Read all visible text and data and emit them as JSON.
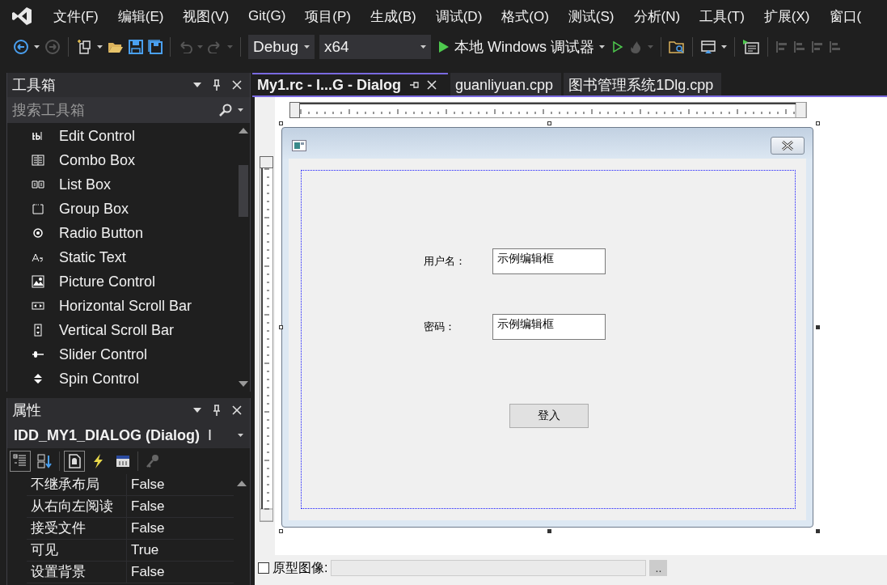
{
  "menu": [
    "文件(F)",
    "编辑(E)",
    "视图(V)",
    "Git(G)",
    "项目(P)",
    "生成(B)",
    "调试(D)",
    "格式(O)",
    "测试(S)",
    "分析(N)",
    "工具(T)",
    "扩展(X)",
    "窗口("
  ],
  "toolbar": {
    "configuration": "Debug",
    "platform": "x64",
    "run_label": "本地 Windows 调试器"
  },
  "toolbox": {
    "title": "工具箱",
    "search": {
      "placeholder": "搜索工具箱"
    },
    "items": [
      {
        "label": "Edit Control"
      },
      {
        "label": "Combo Box"
      },
      {
        "label": "List Box"
      },
      {
        "label": "Group Box"
      },
      {
        "label": "Radio Button"
      },
      {
        "label": "Static Text"
      },
      {
        "label": "Picture Control"
      },
      {
        "label": "Horizontal Scroll Bar"
      },
      {
        "label": "Vertical Scroll Bar"
      },
      {
        "label": "Slider Control"
      },
      {
        "label": "Spin Control"
      }
    ]
  },
  "properties": {
    "title": "属性",
    "object": "IDD_MY1_DIALOG (Dialog)",
    "object_type": "I",
    "rows": [
      {
        "name": "不继承布局",
        "value": "False"
      },
      {
        "name": "从右向左阅读",
        "value": "False"
      },
      {
        "name": "接受文件",
        "value": "False"
      },
      {
        "name": "可见",
        "value": "True"
      },
      {
        "name": "设置背景",
        "value": "False"
      }
    ]
  },
  "tabs": [
    {
      "label": "My1.rc - I...G - Dialog",
      "selected": true
    },
    {
      "label": "guanliyuan.cpp",
      "selected": false
    },
    {
      "label": "图书管理系统1Dlg.cpp",
      "selected": false
    }
  ],
  "dialog": {
    "fields": [
      {
        "label": "用户名：",
        "value": "示例编辑框"
      },
      {
        "label": "密码：",
        "value": "示例编辑框"
      }
    ],
    "button": "登入"
  },
  "prototype": {
    "label": "原型图像:",
    "checked": false,
    "browse": ".."
  }
}
